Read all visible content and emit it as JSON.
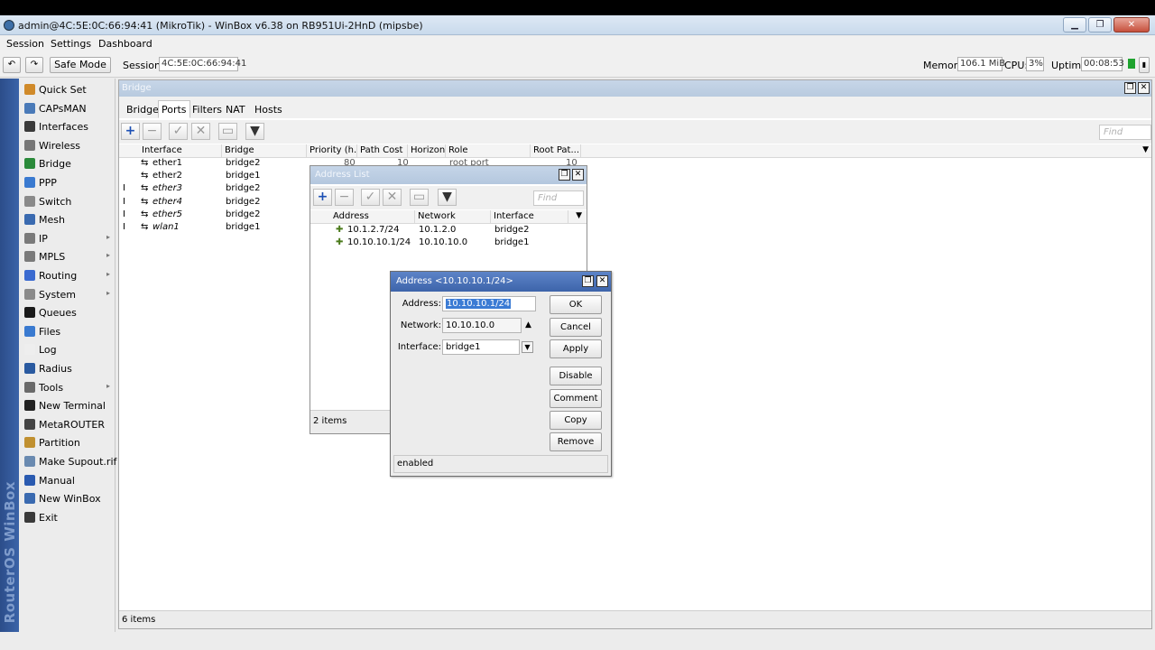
{
  "window": {
    "title": "admin@4C:5E:0C:66:94:41 (MikroTik) - WinBox v6.38 on RB951Ui-2HnD (mipsbe)",
    "controls": [
      "▁",
      "❐",
      "✕"
    ]
  },
  "menu": [
    "Session",
    "Settings",
    "Dashboard"
  ],
  "toolbar": {
    "undo": "↶",
    "redo": "↷",
    "safe_mode": "Safe Mode",
    "session_label": "Session:",
    "session_value": "4C:5E:0C:66:94:41",
    "memory_label": "Memory:",
    "memory_value": "106.1 MiB",
    "cpu_label": "CPU:",
    "cpu_value": "3%",
    "uptime_label": "Uptime:",
    "uptime_value": "00:08:53"
  },
  "brand_vertical": "RouterOS WinBox",
  "sidebar": [
    {
      "label": "Quick Set",
      "icon": "quick-set-icon",
      "color": "#d08a2a",
      "arrow": false
    },
    {
      "label": "CAPsMAN",
      "icon": "capsman-icon",
      "color": "#4a7ab8",
      "arrow": false
    },
    {
      "label": "Interfaces",
      "icon": "interfaces-icon",
      "color": "#3a3a3a",
      "arrow": false
    },
    {
      "label": "Wireless",
      "icon": "wireless-icon",
      "color": "#777777",
      "arrow": false
    },
    {
      "label": "Bridge",
      "icon": "bridge-icon",
      "color": "#2a8a3a",
      "arrow": false
    },
    {
      "label": "PPP",
      "icon": "ppp-icon",
      "color": "#3a7ad0",
      "arrow": false
    },
    {
      "label": "Switch",
      "icon": "switch-icon",
      "color": "#8a8a8a",
      "arrow": false
    },
    {
      "label": "Mesh",
      "icon": "mesh-icon",
      "color": "#3a6ab0",
      "arrow": false
    },
    {
      "label": "IP",
      "icon": "ip-icon",
      "color": "#7a7a7a",
      "arrow": true
    },
    {
      "label": "MPLS",
      "icon": "mpls-icon",
      "color": "#7a7a7a",
      "arrow": true
    },
    {
      "label": "Routing",
      "icon": "routing-icon",
      "color": "#3a6ad0",
      "arrow": true
    },
    {
      "label": "System",
      "icon": "system-icon",
      "color": "#8a8a8a",
      "arrow": true
    },
    {
      "label": "Queues",
      "icon": "queues-icon",
      "color": "#1a1a1a",
      "arrow": false
    },
    {
      "label": "Files",
      "icon": "files-icon",
      "color": "#3a7ad0",
      "arrow": false
    },
    {
      "label": "Log",
      "icon": "log-icon",
      "color": "#eeeeee",
      "arrow": false
    },
    {
      "label": "Radius",
      "icon": "radius-icon",
      "color": "#2a5aa0",
      "arrow": false
    },
    {
      "label": "Tools",
      "icon": "tools-icon",
      "color": "#6a6a6a",
      "arrow": true
    },
    {
      "label": "New Terminal",
      "icon": "terminal-icon",
      "color": "#222222",
      "arrow": false
    },
    {
      "label": "MetaROUTER",
      "icon": "metarouter-icon",
      "color": "#444444",
      "arrow": false
    },
    {
      "label": "Partition",
      "icon": "partition-icon",
      "color": "#c09030",
      "arrow": false
    },
    {
      "label": "Make Supout.rif",
      "icon": "supout-icon",
      "color": "#6a8ab0",
      "arrow": false
    },
    {
      "label": "Manual",
      "icon": "manual-icon",
      "color": "#2a5ab0",
      "arrow": false
    },
    {
      "label": "New WinBox",
      "icon": "winbox-icon",
      "color": "#3a6ab0",
      "arrow": false
    },
    {
      "label": "Exit",
      "icon": "exit-icon",
      "color": "#3a3a3a",
      "arrow": false
    }
  ],
  "bridge_window": {
    "title": "Bridge",
    "tabs": [
      "Bridge",
      "Ports",
      "Filters",
      "NAT",
      "Hosts"
    ],
    "active_tab": "Ports",
    "find_placeholder": "Find",
    "columns": [
      "Interface",
      "Bridge",
      "Priority (h...",
      "Path Cost",
      "Horizon",
      "Role",
      "Root Pat..."
    ],
    "rows": [
      {
        "flag": "",
        "interface": "ether1",
        "bridge": "bridge2",
        "italic": false
      },
      {
        "flag": "",
        "interface": "ether2",
        "bridge": "bridge1",
        "italic": false
      },
      {
        "flag": "I",
        "interface": "ether3",
        "bridge": "bridge2",
        "italic": true
      },
      {
        "flag": "I",
        "interface": "ether4",
        "bridge": "bridge2",
        "italic": true
      },
      {
        "flag": "I",
        "interface": "ether5",
        "bridge": "bridge2",
        "italic": true
      },
      {
        "flag": "I",
        "interface": "wlan1",
        "bridge": "bridge1",
        "italic": true
      }
    ],
    "row1_partial": {
      "priority": "80",
      "path_cost": "10",
      "role": "root port",
      "root_path": "10"
    },
    "status": "6 items"
  },
  "address_list": {
    "title": "Address List",
    "find_placeholder": "Find",
    "columns": [
      "Address",
      "Network",
      "Interface"
    ],
    "rows": [
      {
        "address": "10.1.2.7/24",
        "network": "10.1.2.0",
        "interface": "bridge2"
      },
      {
        "address": "10.10.10.1/24",
        "network": "10.10.10.0",
        "interface": "bridge1"
      }
    ],
    "status": "2 items"
  },
  "dialog": {
    "title": "Address <10.10.10.1/24>",
    "address_label": "Address:",
    "address_value": "10.10.10.1/24",
    "network_label": "Network:",
    "network_value": "10.10.10.0",
    "interface_label": "Interface:",
    "interface_value": "bridge1",
    "buttons": [
      "OK",
      "Cancel",
      "Apply",
      "Disable",
      "Comment",
      "Copy",
      "Remove"
    ],
    "status": "enabled"
  }
}
